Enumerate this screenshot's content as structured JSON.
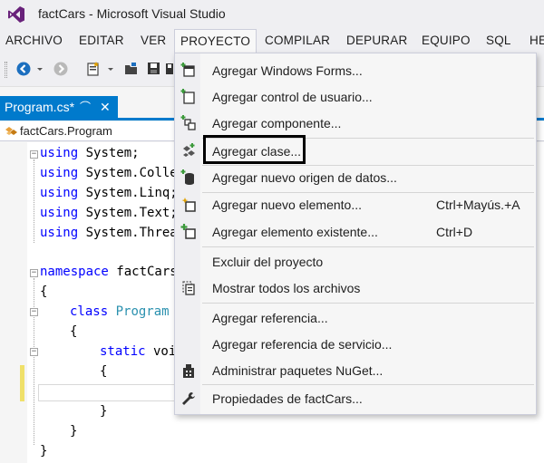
{
  "window": {
    "title": "factCars - Microsoft Visual Studio"
  },
  "menubar": {
    "items": [
      "ARCHIVO",
      "EDITAR",
      "VER",
      "PROYECTO",
      "COMPILAR",
      "DEPURAR",
      "EQUIPO",
      "SQL",
      "HE"
    ],
    "active": "PROYECTO"
  },
  "document_tab": {
    "label": "Program.cs*",
    "pin_glyph": "⌒",
    "close_glyph": "✕"
  },
  "navigation": {
    "scope": "factCars.Program"
  },
  "editor": {
    "lines": [
      {
        "kw": "using",
        "rest": " System;"
      },
      {
        "kw": "using",
        "rest": " System.Colle"
      },
      {
        "kw": "using",
        "rest": " System.Linq;"
      },
      {
        "kw": "using",
        "rest": " System.Text;"
      },
      {
        "kw": "using",
        "rest": " System.Threa"
      },
      {
        "kw": "namespace",
        "rest": " factCars"
      },
      {
        "text": "{"
      },
      {
        "kw": "class",
        "type": " Program"
      },
      {
        "text": "{"
      },
      {
        "kw": "static",
        "rest": " voi"
      },
      {
        "text": "{"
      },
      {
        "text": "}"
      },
      {
        "text": "}"
      },
      {
        "text": "}"
      }
    ]
  },
  "project_menu": {
    "items": [
      {
        "label": "Agregar Windows Forms...",
        "shortcut": "",
        "icon": "windows-form-icon"
      },
      {
        "label": "Agregar control de usuario...",
        "shortcut": "",
        "icon": "user-control-icon"
      },
      {
        "label": "Agregar componente...",
        "shortcut": "",
        "icon": "component-icon"
      },
      {
        "label": "Agregar clase...",
        "shortcut": "",
        "icon": "class-icon"
      },
      {
        "label": "Agregar nuevo origen de datos...",
        "shortcut": "",
        "icon": "data-source-icon"
      },
      {
        "label": "Agregar nuevo elemento...",
        "shortcut": "Ctrl+Mayús.+A",
        "icon": "new-item-icon"
      },
      {
        "label": "Agregar elemento existente...",
        "shortcut": "Ctrl+D",
        "icon": "existing-item-icon"
      },
      {
        "label": "Excluir del proyecto",
        "shortcut": "",
        "icon": ""
      },
      {
        "label": "Mostrar todos los archivos",
        "shortcut": "",
        "icon": "show-all-files-icon"
      },
      {
        "label": "Agregar referencia...",
        "shortcut": "",
        "icon": ""
      },
      {
        "label": "Agregar referencia de servicio...",
        "shortcut": "",
        "icon": ""
      },
      {
        "label": "Administrar paquetes NuGet...",
        "shortcut": "",
        "icon": "nuget-icon"
      },
      {
        "label": "Propiedades de factCars...",
        "shortcut": "",
        "icon": "wrench-icon"
      }
    ],
    "highlighted": "Agregar clase..."
  },
  "colors": {
    "accent": "#007acc",
    "keyword": "#0000ff",
    "type": "#2b91af",
    "vs_logo": "#68217a",
    "change_marker": "#efe06a",
    "icon_green": "#3c9a3c"
  }
}
